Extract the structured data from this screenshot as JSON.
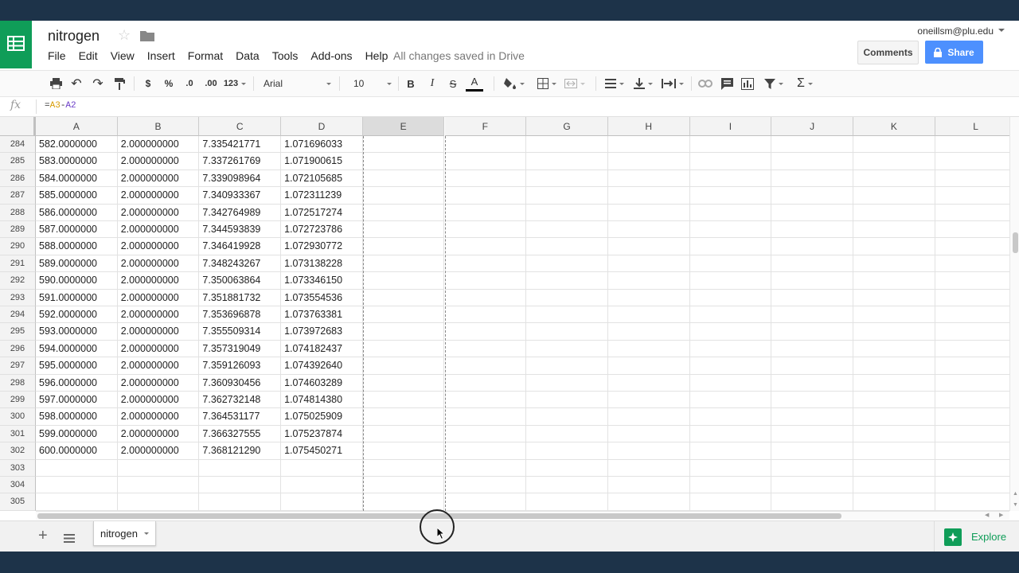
{
  "document": {
    "title": "nitrogen",
    "save_status": "All changes saved in Drive",
    "account": "oneillsm@plu.edu"
  },
  "menu": [
    "File",
    "Edit",
    "View",
    "Insert",
    "Format",
    "Data",
    "Tools",
    "Add-ons",
    "Help"
  ],
  "buttons": {
    "comments": "Comments",
    "share": "Share"
  },
  "toolbar": {
    "currency": "$",
    "percent": "%",
    "decrease_decimal": ".0",
    "increase_decimal": ".00",
    "more_formats": "123",
    "font": "Arial",
    "font_size": "10",
    "bold": "B",
    "italic": "I",
    "strike": "S",
    "text_color": "A",
    "text_color_hex": "#000000"
  },
  "formula_bar": {
    "fx": "fx",
    "eq": "=",
    "ref1": "A3",
    "op": "-",
    "ref2": "A2"
  },
  "columns": [
    "A",
    "B",
    "C",
    "D",
    "E",
    "F",
    "G",
    "H",
    "I",
    "J",
    "K",
    "L"
  ],
  "selected_column": "E",
  "rows": [
    {
      "num": "284",
      "cells": [
        "582.0000000",
        "2.000000000",
        "7.335421771",
        "1.071696033"
      ]
    },
    {
      "num": "285",
      "cells": [
        "583.0000000",
        "2.000000000",
        "7.337261769",
        "1.071900615"
      ]
    },
    {
      "num": "286",
      "cells": [
        "584.0000000",
        "2.000000000",
        "7.339098964",
        "1.072105685"
      ]
    },
    {
      "num": "287",
      "cells": [
        "585.0000000",
        "2.000000000",
        "7.340933367",
        "1.072311239"
      ]
    },
    {
      "num": "288",
      "cells": [
        "586.0000000",
        "2.000000000",
        "7.342764989",
        "1.072517274"
      ]
    },
    {
      "num": "289",
      "cells": [
        "587.0000000",
        "2.000000000",
        "7.344593839",
        "1.072723786"
      ]
    },
    {
      "num": "290",
      "cells": [
        "588.0000000",
        "2.000000000",
        "7.346419928",
        "1.072930772"
      ]
    },
    {
      "num": "291",
      "cells": [
        "589.0000000",
        "2.000000000",
        "7.348243267",
        "1.073138228"
      ]
    },
    {
      "num": "292",
      "cells": [
        "590.0000000",
        "2.000000000",
        "7.350063864",
        "1.073346150"
      ]
    },
    {
      "num": "293",
      "cells": [
        "591.0000000",
        "2.000000000",
        "7.351881732",
        "1.073554536"
      ]
    },
    {
      "num": "294",
      "cells": [
        "592.0000000",
        "2.000000000",
        "7.353696878",
        "1.073763381"
      ]
    },
    {
      "num": "295",
      "cells": [
        "593.0000000",
        "2.000000000",
        "7.355509314",
        "1.073972683"
      ]
    },
    {
      "num": "296",
      "cells": [
        "594.0000000",
        "2.000000000",
        "7.357319049",
        "1.074182437"
      ]
    },
    {
      "num": "297",
      "cells": [
        "595.0000000",
        "2.000000000",
        "7.359126093",
        "1.074392640"
      ]
    },
    {
      "num": "298",
      "cells": [
        "596.0000000",
        "2.000000000",
        "7.360930456",
        "1.074603289"
      ]
    },
    {
      "num": "299",
      "cells": [
        "597.0000000",
        "2.000000000",
        "7.362732148",
        "1.074814380"
      ]
    },
    {
      "num": "300",
      "cells": [
        "598.0000000",
        "2.000000000",
        "7.364531177",
        "1.075025909"
      ]
    },
    {
      "num": "301",
      "cells": [
        "599.0000000",
        "2.000000000",
        "7.366327555",
        "1.075237874"
      ]
    },
    {
      "num": "302",
      "cells": [
        "600.0000000",
        "2.000000000",
        "7.368121290",
        "1.075450271"
      ]
    },
    {
      "num": "303",
      "cells": [
        "",
        "",
        "",
        ""
      ]
    },
    {
      "num": "304",
      "cells": [
        "",
        "",
        "",
        ""
      ]
    },
    {
      "num": "305",
      "cells": [
        "",
        "",
        "",
        ""
      ]
    }
  ],
  "sheets": [
    {
      "name": "nitrogen",
      "active": true
    }
  ],
  "explore": {
    "label": "Explore"
  },
  "icons": {
    "logo": "sheets-logo-icon",
    "star": "star-icon",
    "folder": "folder-icon",
    "lock": "lock-icon"
  },
  "colors": {
    "brand_green": "#0f9d58",
    "share_blue": "#4d90fe"
  }
}
